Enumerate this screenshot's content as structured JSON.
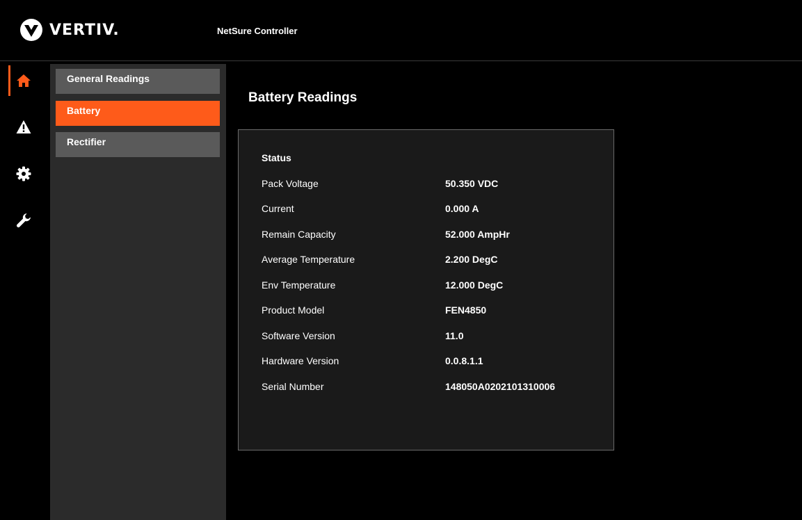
{
  "brand": {
    "logo_text": "VERTIV.",
    "app_title": "NetSure Controller",
    "accent_color": "#fe5b1a"
  },
  "rail": [
    {
      "icon": "home-icon",
      "active": true
    },
    {
      "icon": "alert-icon",
      "active": false
    },
    {
      "icon": "gear-icon",
      "active": false
    },
    {
      "icon": "wrench-icon",
      "active": false
    }
  ],
  "subnav": [
    {
      "label": "General Readings",
      "active": false
    },
    {
      "label": "Battery",
      "active": true
    },
    {
      "label": "Rectifier",
      "active": false
    }
  ],
  "page": {
    "title": "Battery Readings",
    "section_title": "Status",
    "rows": [
      {
        "label": "Pack Voltage",
        "value": "50.350 VDC"
      },
      {
        "label": "Current",
        "value": "0.000 A"
      },
      {
        "label": "Remain Capacity",
        "value": "52.000 AmpHr"
      },
      {
        "label": "Average Temperature",
        "value": "2.200 DegC"
      },
      {
        "label": "Env Temperature",
        "value": "12.000 DegC"
      },
      {
        "label": "Product Model",
        "value": "FEN4850"
      },
      {
        "label": "Software Version",
        "value": "11.0"
      },
      {
        "label": "Hardware Version",
        "value": "0.0.8.1.1"
      },
      {
        "label": "Serial Number",
        "value": "148050A0202101310006"
      }
    ]
  }
}
